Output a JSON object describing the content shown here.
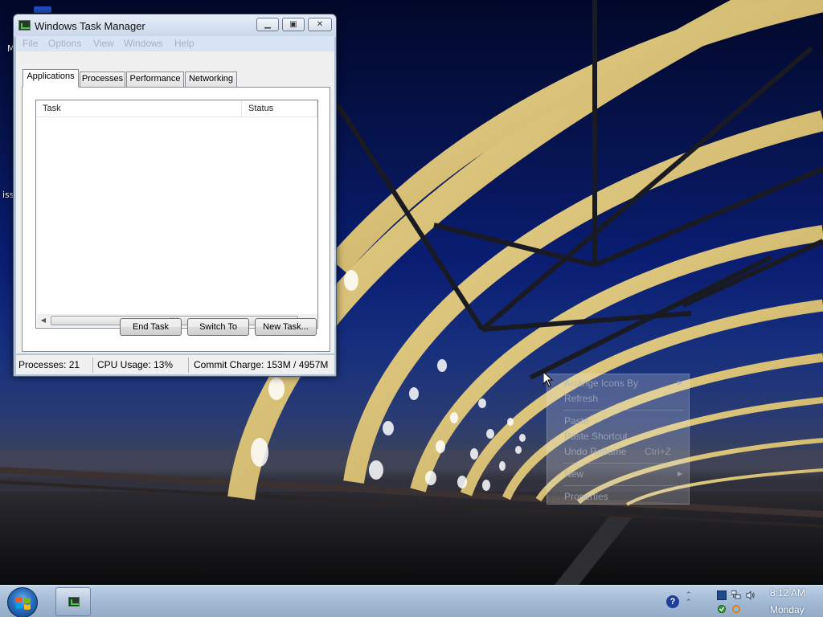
{
  "desktop": {
    "edge_fragment_1": "M",
    "edge_fragment_2": "iss"
  },
  "window": {
    "title": "Windows Task Manager",
    "menu": [
      "File",
      "Options",
      "View",
      "Windows",
      "Help"
    ],
    "tabs": [
      "Applications",
      "Processes",
      "Performance",
      "Networking"
    ],
    "active_tab": "Applications",
    "columns": [
      "Task",
      "Status"
    ],
    "tasks": [],
    "buttons": {
      "end_task": "End Task",
      "switch_to": "Switch To",
      "new_task": "New Task..."
    },
    "status": {
      "processes": "Processes: 21",
      "cpu": "CPU Usage: 13%",
      "commit": "Commit Charge: 153M / 4957M"
    }
  },
  "context_menu": {
    "items": [
      {
        "label": "Arrange Icons By",
        "submenu": true
      },
      {
        "label": "Refresh"
      },
      {
        "label": "Paste"
      },
      {
        "label": "Paste Shortcut"
      },
      {
        "label": "Undo Rename",
        "shortcut": "Ctrl+Z"
      },
      {
        "label": "New",
        "submenu": true
      },
      {
        "label": "Properties"
      }
    ]
  },
  "taskbar": {
    "time": "8:12 AM",
    "day": "Monday",
    "help_glyph": "?"
  },
  "icons": {
    "start": "windows-logo-icon",
    "task_manager": "task-manager-icon",
    "help": "help-icon",
    "tray": [
      "tray-chevron-icon",
      "network-icon",
      "volume-icon",
      "security-icon",
      "update-icon"
    ]
  },
  "colors": {
    "sky_top": "#02082a",
    "sky_mid": "#0a1d72",
    "bridge": "#e8d38a",
    "taskbar": "#a3bad4"
  }
}
